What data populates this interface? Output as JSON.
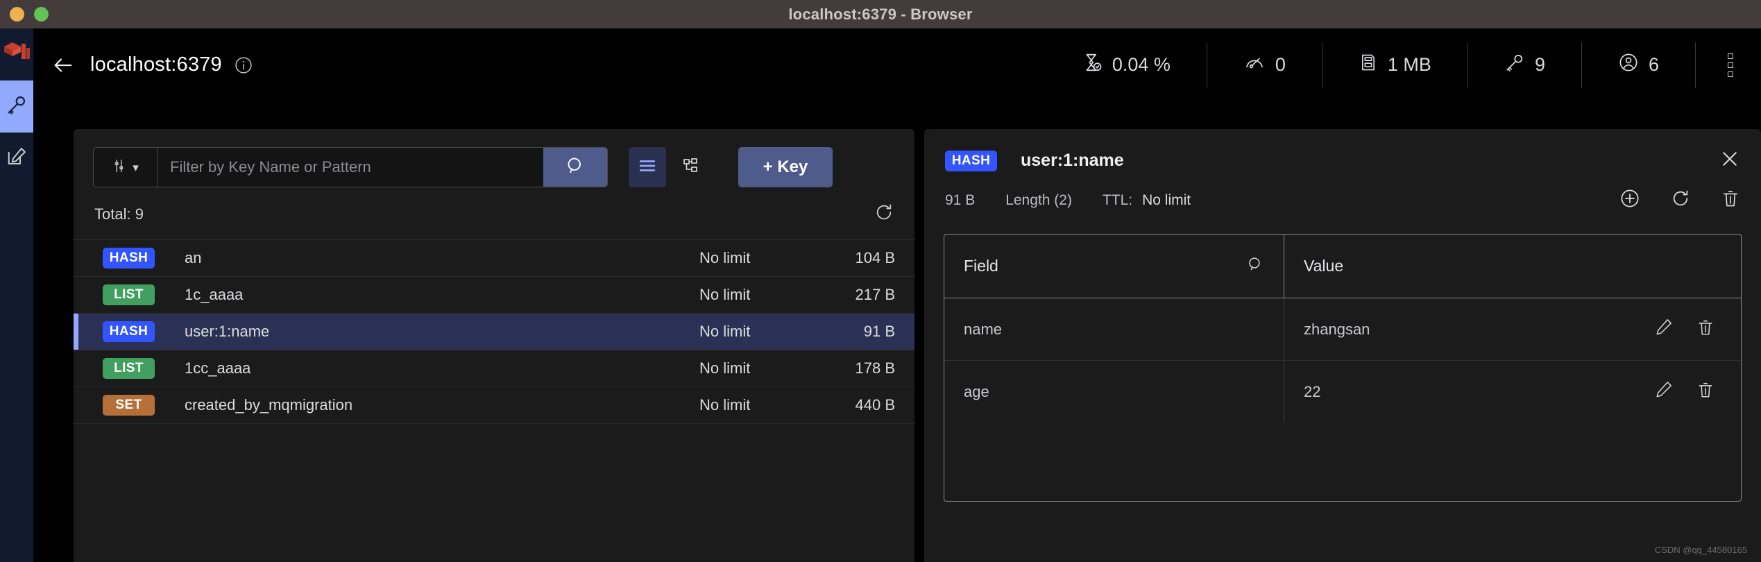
{
  "window": {
    "title": "localhost:6379 - Browser",
    "dots": [
      "yellow",
      "green"
    ]
  },
  "sidebar": {
    "items": [
      {
        "name": "redis-logo",
        "label": "Redis"
      },
      {
        "name": "browser",
        "label": "Browser",
        "active": true
      },
      {
        "name": "workbench",
        "label": "Workbench",
        "active": false
      }
    ]
  },
  "header": {
    "back_label": "Back",
    "host": "localhost:6379",
    "info_label": "Info",
    "metrics": [
      {
        "icon": "hourglass-icon",
        "value": "0.04 %",
        "name": "cpu-metric"
      },
      {
        "icon": "gauge-icon",
        "value": "0",
        "name": "commands-metric"
      },
      {
        "icon": "memory-icon",
        "value": "1 MB",
        "name": "memory-metric"
      },
      {
        "icon": "key-icon",
        "value": "9",
        "name": "keys-metric"
      },
      {
        "icon": "user-icon",
        "value": "6",
        "name": "clients-metric"
      }
    ],
    "kebab_label": "More options"
  },
  "browser": {
    "filter": {
      "type_label": "Key Type",
      "placeholder": "Filter by Key Name or Pattern",
      "value": "",
      "search_label": "Search"
    },
    "view_toggles": [
      {
        "name": "list-view-toggle",
        "label": "List view",
        "active": true
      },
      {
        "name": "tree-view-toggle",
        "label": "Tree view",
        "active": false
      }
    ],
    "add_key_label": "+ Key",
    "total_label": "Total: 9",
    "refresh_label": "Refresh",
    "keys": [
      {
        "type": "HASH",
        "type_class": "hash",
        "name": "an",
        "ttl": "No limit",
        "size": "104 B",
        "selected": false
      },
      {
        "type": "LIST",
        "type_class": "list",
        "name": "1c_aaaa",
        "ttl": "No limit",
        "size": "217 B",
        "selected": false
      },
      {
        "type": "HASH",
        "type_class": "hash",
        "name": "user:1:name",
        "ttl": "No limit",
        "size": "91 B",
        "selected": true
      },
      {
        "type": "LIST",
        "type_class": "list",
        "name": "1cc_aaaa",
        "ttl": "No limit",
        "size": "178 B",
        "selected": false
      },
      {
        "type": "SET",
        "type_class": "set",
        "name": "created_by_mqmigration",
        "ttl": "No limit",
        "size": "440 B",
        "selected": false
      }
    ]
  },
  "details": {
    "type": "HASH",
    "type_class": "hash",
    "key_name": "user:1:name",
    "size": "91 B",
    "length": "Length (2)",
    "ttl_label": "TTL:",
    "ttl_value": "No limit",
    "close_label": "Close",
    "add_label": "Add field",
    "refresh_label": "Refresh",
    "delete_label": "Delete key",
    "columns": {
      "field": "Field",
      "value": "Value",
      "search_label": "Search field"
    },
    "rows": [
      {
        "field": "name",
        "value": "zhangsan",
        "edit_label": "Edit",
        "delete_label": "Delete"
      },
      {
        "field": "age",
        "value": "22",
        "edit_label": "Edit",
        "delete_label": "Delete"
      }
    ]
  },
  "watermark": "CSDN @qq_44580165",
  "colors": {
    "accent": "#4f5b8b",
    "selected_row": "#2b3154",
    "selection_bar": "#93a9fb",
    "hash_badge": "#3355ff",
    "list_badge": "#41a05f",
    "set_badge": "#b5703a",
    "titlebar": "#443b3d",
    "panel_bg": "#1b1b1b",
    "sidebar_bg": "#111a2e"
  }
}
